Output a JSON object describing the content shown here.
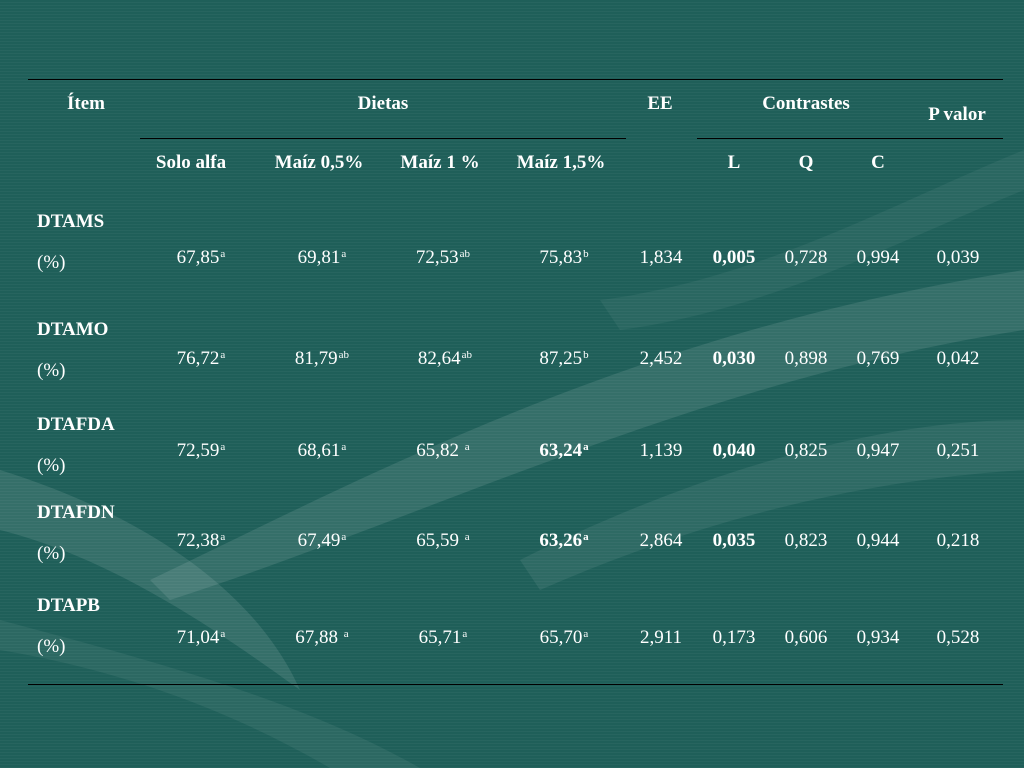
{
  "colors": {
    "background": "#1f5f59",
    "text": "#ffffff",
    "rules": "#000000"
  },
  "table": {
    "header": {
      "item": "Ítem",
      "dietas": "Dietas",
      "ee": "EE",
      "contrastes": "Contrastes",
      "p_valor": "P valor",
      "solo_alfa": "Solo alfa",
      "maiz_05": "Maíz 0,5%",
      "maiz_1": "Maíz 1 %",
      "maiz_15": "Maíz 1,5%",
      "l": "L",
      "q": "Q",
      "c": "C"
    },
    "rows": [
      {
        "name": "DTAMS",
        "unit": "(%)",
        "d1": "67,85",
        "d1s": "a",
        "d2": "69,81",
        "d2s": "a",
        "d3": "72,53",
        "d3s": "ab",
        "d4": "75,83",
        "d4s": "b",
        "ee": "1,834",
        "l": "0,005",
        "q": "0,728",
        "c": "0,994",
        "p": "0,039"
      },
      {
        "name": "DTAMO",
        "unit": "(%)",
        "d1": "76,72",
        "d1s": "a",
        "d2": "81,79",
        "d2s": "ab",
        "d3": "82,64",
        "d3s": "ab",
        "d4": "87,25",
        "d4s": "b",
        "ee": "2,452",
        "l": "0,030",
        "q": "0,898",
        "c": "0,769",
        "p": "0,042"
      },
      {
        "name": "DTAFDA",
        "unit": "(%)",
        "d1": "72,59",
        "d1s": "a",
        "d2": "68,61",
        "d2s": "a",
        "d3": "65,82 ",
        "d3s": "a",
        "d4": "63,24",
        "d4s": "a",
        "ee": "1,139",
        "l": "0,040",
        "q": "0,825",
        "c": "0,947",
        "p": "0,251"
      },
      {
        "name": "DTAFDN",
        "unit": "(%)",
        "d1": "72,38",
        "d1s": "a",
        "d2": "67,49",
        "d2s": "a",
        "d3": "65,59 ",
        "d3s": "a",
        "d4": "63,26",
        "d4s": "a",
        "ee": "2,864",
        "l": "0,035",
        "q": "0,823",
        "c": "0,944",
        "p": "0,218"
      },
      {
        "name": "DTAPB",
        "unit": "(%)",
        "d1": "71,04",
        "d1s": "a",
        "d2": "67,88 ",
        "d2s": "a",
        "d3": "65,71",
        "d3s": "a",
        "d4": "65,70",
        "d4s": "a",
        "ee": "2,911",
        "l": "0,173",
        "q": "0,606",
        "c": "0,934",
        "p": "0,528"
      }
    ]
  }
}
